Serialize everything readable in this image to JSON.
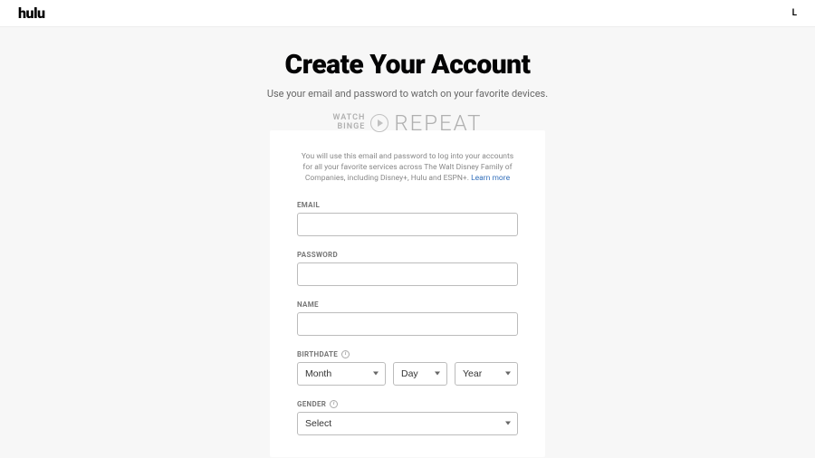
{
  "header": {
    "logo": "hulu",
    "login": "L"
  },
  "page": {
    "title": "Create Your Account",
    "subtitle": "Use your email and password to watch on your favorite devices."
  },
  "tagline": {
    "watch": "WATCH",
    "binge": "BINGE",
    "repeat": "REPEAT"
  },
  "card": {
    "intro_text": "You will use this email and password to log into your accounts for all your favorite services across The Walt Disney Family of Companies, including Disney+, Hulu and ESPN+. ",
    "learn_more": "Learn more"
  },
  "form": {
    "email_label": "EMAIL",
    "email_value": "",
    "password_label": "PASSWORD",
    "password_value": "",
    "name_label": "NAME",
    "name_value": "",
    "birthdate_label": "BIRTHDATE",
    "month_selected": "Month",
    "day_selected": "Day",
    "year_selected": "Year",
    "gender_label": "GENDER",
    "gender_selected": "Select"
  }
}
